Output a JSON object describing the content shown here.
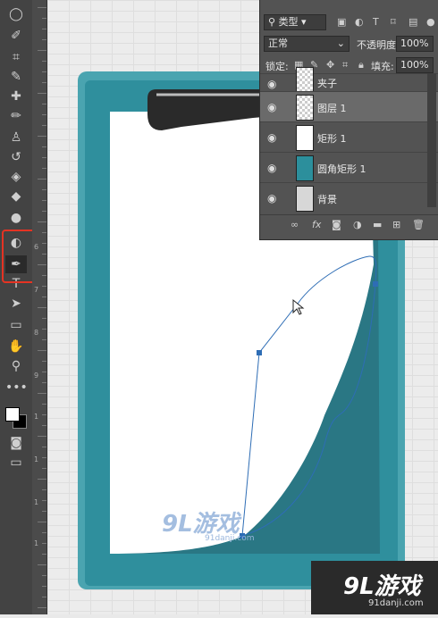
{
  "toolbar": {
    "tools": [
      {
        "name": "lasso-tool",
        "glyph": "◯"
      },
      {
        "name": "quick-select-tool",
        "glyph": "✐"
      },
      {
        "name": "crop-tool",
        "glyph": "⌗"
      },
      {
        "name": "eyedropper-tool",
        "glyph": "✎"
      },
      {
        "name": "healing-brush-tool",
        "glyph": "✚"
      },
      {
        "name": "brush-tool",
        "glyph": "✏"
      },
      {
        "name": "clone-stamp-tool",
        "glyph": "♙"
      },
      {
        "name": "history-brush-tool",
        "glyph": "↺"
      },
      {
        "name": "eraser-tool",
        "glyph": "◈"
      },
      {
        "name": "paint-bucket-tool",
        "glyph": "◆"
      },
      {
        "name": "blur-tool",
        "glyph": "●"
      },
      {
        "name": "dodge-tool",
        "glyph": "◐"
      },
      {
        "name": "pen-tool",
        "glyph": "✒"
      },
      {
        "name": "type-tool",
        "glyph": "T"
      },
      {
        "name": "path-selection-tool",
        "glyph": "➤"
      },
      {
        "name": "rectangle-tool",
        "glyph": "▭"
      },
      {
        "name": "hand-tool",
        "glyph": "✋"
      },
      {
        "name": "zoom-tool",
        "glyph": "⚲"
      },
      {
        "name": "more-tools",
        "glyph": "•••"
      }
    ],
    "active_tool": "pen-tool",
    "highlight_color": "#e53323"
  },
  "ruler": {
    "numbers": [
      "6",
      "7",
      "8",
      "9",
      "1",
      "1",
      "1",
      "1"
    ]
  },
  "layers_panel": {
    "filter_label": "类型",
    "blend_mode": "正常",
    "opacity_label": "不透明度:",
    "opacity_value": "100%",
    "lock_label": "锁定:",
    "fill_label": "填充:",
    "fill_value": "100%",
    "layers": [
      {
        "name": "夹子",
        "thumb": "checker"
      },
      {
        "name": "图层 1",
        "thumb": "checker",
        "selected": true
      },
      {
        "name": "矩形 1",
        "thumb": "white"
      },
      {
        "name": "圆角矩形 1",
        "thumb": "teal"
      },
      {
        "name": "背景",
        "thumb": "gray"
      }
    ],
    "bottom_icons": [
      "link-icon",
      "fx-icon",
      "mask-icon",
      "adjustment-icon",
      "group-icon",
      "new-layer-icon",
      "trash-icon"
    ],
    "fx_text": "fx"
  },
  "canvas": {
    "board_color": "#2f8f9d",
    "paper_color": "#ffffff",
    "curl_color": "#2a7784",
    "path_color": "#2e6db5"
  },
  "watermark": {
    "brand": "9L游戏",
    "url": "91danji.com",
    "inline_brand": "9L游戏",
    "inline_url": "91danji.com"
  }
}
